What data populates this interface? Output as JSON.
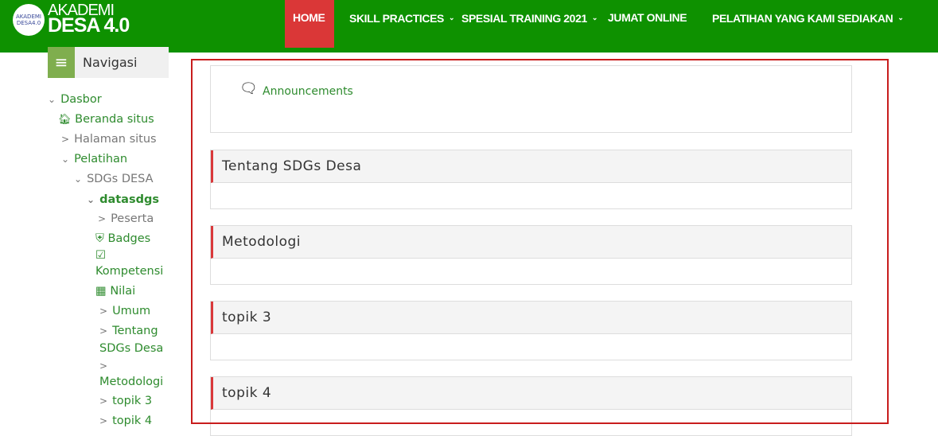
{
  "brand": {
    "logo_line1": "AKADEMI",
    "logo_line2": "DESA 4.0"
  },
  "topnav": [
    {
      "label": "HOME",
      "active": true
    },
    {
      "label": "SKILL PRACTICES",
      "dropdown": true
    },
    {
      "label": "SPESIAL TRAINING 2021",
      "dropdown": true
    },
    {
      "label": "JUMAT ONLINE"
    },
    {
      "label": "PELATIHAN YANG KAMI SEDIAKAN",
      "dropdown": true
    }
  ],
  "sidebar": {
    "title": "Navigasi",
    "items": [
      "Dasbor",
      "Beranda situs",
      "Halaman situs",
      "Pelatihan",
      "SDGs DESA",
      "datasdgs",
      "Peserta",
      "Badges",
      "Kompetensi",
      "Nilai",
      "Umum",
      "Tentang",
      "SDGs Desa",
      "Metodologi",
      "topik 3",
      "topik 4"
    ]
  },
  "main": {
    "announcements": "Announcements",
    "sections": [
      "Tentang SDGs Desa",
      "Metodologi",
      "topik 3",
      "topik 4"
    ]
  },
  "colors": {
    "header": "#0e9100",
    "home": "#da3737",
    "link": "#2e8b2e",
    "highlight": "#c81d1d"
  }
}
